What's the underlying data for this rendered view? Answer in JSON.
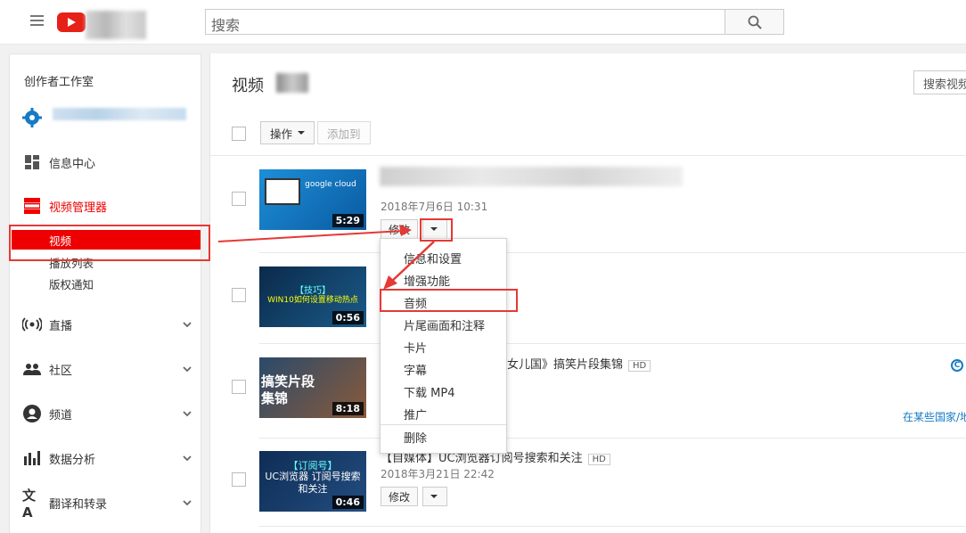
{
  "header": {
    "search_placeholder": "搜索"
  },
  "sidebar": {
    "title": "创作者工作室",
    "items": [
      {
        "label": "信息中心"
      },
      {
        "label": "视频管理器"
      },
      {
        "label": "直播"
      },
      {
        "label": "社区"
      },
      {
        "label": "频道"
      },
      {
        "label": "数据分析"
      },
      {
        "label": "翻译和转录"
      }
    ],
    "sub_items": [
      {
        "label": "视频"
      },
      {
        "label": "播放列表"
      },
      {
        "label": "版权通知"
      }
    ]
  },
  "main": {
    "title": "视频",
    "search_videos_label": "搜索视频",
    "actions_label": "操作",
    "add_to_label": "添加到",
    "videos": [
      {
        "duration": "5:29",
        "date": "2018年7月6日 10:31",
        "edit_label": "修改",
        "thumb_text": "google cloud"
      },
      {
        "duration": "0:56",
        "thumb_text": "WIN10如何设置移动热点",
        "thumb_tag": "【技巧】"
      },
      {
        "duration": "8:18",
        "title_suffix": "女儿国》搞笑片段集锦",
        "hd": "HD",
        "thumb_text": "搞笑片段集锦"
      },
      {
        "duration": "0:46",
        "title": "【自媒体】UC浏览器订阅号搜索和关注",
        "hd": "HD",
        "date": "2018年3月21日 22:42",
        "edit_label": "修改",
        "thumb_tag": "【订阅号】",
        "thumb_text": "UC浏览器 订阅号搜索和关注"
      }
    ],
    "right_link": "在某些国家/地",
    "right_icon": "copyright-icon"
  },
  "dropdown": {
    "items": [
      {
        "label": "信息和设置"
      },
      {
        "label": "增强功能"
      },
      {
        "label": "音频"
      },
      {
        "label": "片尾画面和注释"
      },
      {
        "label": "卡片"
      },
      {
        "label": "字幕"
      },
      {
        "label": "下载 MP4"
      },
      {
        "label": "推广"
      },
      {
        "label": "删除"
      }
    ]
  },
  "colors": {
    "brand_red": "#e62117",
    "active_red": "#ee0000",
    "annotation_red": "#e53935",
    "link_blue": "#167ac6"
  }
}
